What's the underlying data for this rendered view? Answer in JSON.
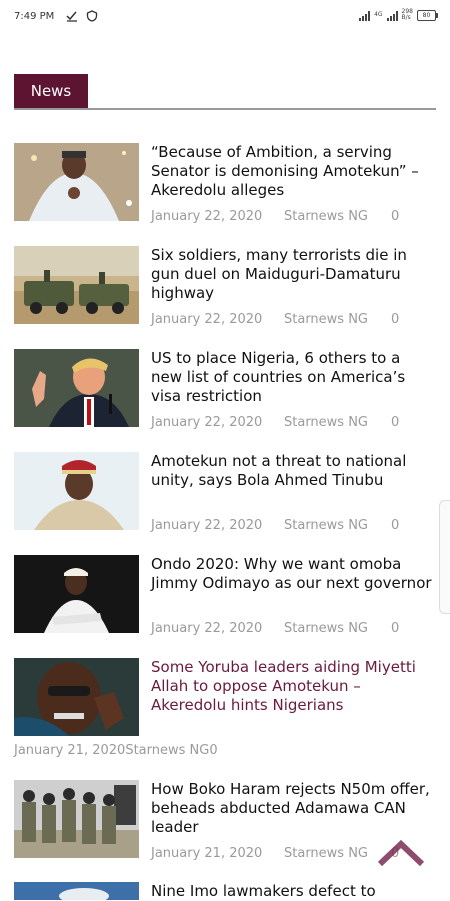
{
  "status": {
    "time": "7:49 PM",
    "net_top": "4G",
    "net_bottom": "",
    "speed_top": "298",
    "speed_bottom": "B/s",
    "battery": "80"
  },
  "section": {
    "tab_label": "News"
  },
  "articles": [
    {
      "title": "“Because of Ambition, a serving Senator is demonising Amotekun” – Akeredolu alleges",
      "date": "January 22, 2020",
      "source": "Starnews NG",
      "count": "0"
    },
    {
      "title": "Six soldiers, many terrorists die in gun duel on Maiduguri-Damaturu highway",
      "date": "January 22, 2020",
      "source": "Starnews NG",
      "count": "0"
    },
    {
      "title": "US to place Nigeria, 6 others to a new list of countries on America’s visa restriction",
      "date": "January 22, 2020",
      "source": "Starnews NG",
      "count": "0"
    },
    {
      "title": "Amotekun not a threat to national unity, says Bola Ahmed Tinubu",
      "date": "January 22, 2020",
      "source": "Starnews NG",
      "count": "0"
    },
    {
      "title": "Ondo 2020: Why we want omoba Jimmy Odimayo as our next governor",
      "date": "January 22, 2020",
      "source": "Starnews NG",
      "count": "0"
    },
    {
      "title": "Some Yoruba leaders aiding Miyetti Allah to oppose Amotekun – Akeredolu hints Nigerians",
      "date": "January 21, 2020",
      "source": "Starnews NG",
      "count": "0"
    },
    {
      "title": "How Boko Haram rejects N50m offer, beheads abducted Adamawa CAN leader",
      "date": "January 21, 2020",
      "source": "Starnews NG",
      "count": "0"
    },
    {
      "title": "Nine Imo lawmakers defect to"
    }
  ],
  "colors": {
    "accent": "#5c1431",
    "highlight_title": "#6b1a3c",
    "meta": "#9a9a9a"
  }
}
